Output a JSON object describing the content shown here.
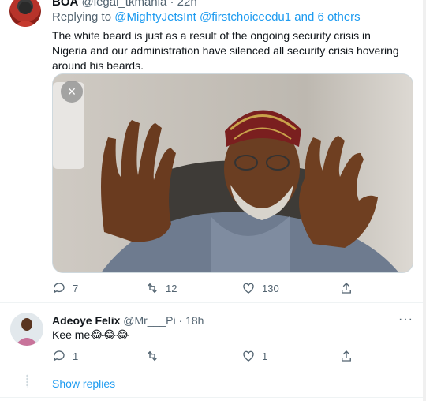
{
  "tweet1": {
    "name": "BOA",
    "handle": "@legal_tkmania",
    "time": "22h",
    "replying_prefix": "Replying to ",
    "mentions": [
      "@MightyJetsInt",
      "@firstchoiceedu1"
    ],
    "replying_suffix": " and 6 others",
    "and_connector": " ",
    "text": "The white beard is just as a result of the ongoing security crisis in Nigeria and our administration have silenced all security crisis hovering around his beards.",
    "media": {
      "close_symbol": "×"
    },
    "stats": {
      "replies": "7",
      "retweets": "12",
      "likes": "130"
    }
  },
  "tweet2": {
    "name": "Adeoye Felix",
    "handle": "@Mr___Pi",
    "separator": " · ",
    "time": "18h",
    "text": "Kee me😂😂😂",
    "more_symbol": "···",
    "stats": {
      "replies": "1",
      "retweets": "",
      "likes": "1"
    }
  },
  "show_replies": "Show replies",
  "colors": {
    "accent": "#1d9bf0",
    "muted": "#536471",
    "text": "#0f1419"
  }
}
